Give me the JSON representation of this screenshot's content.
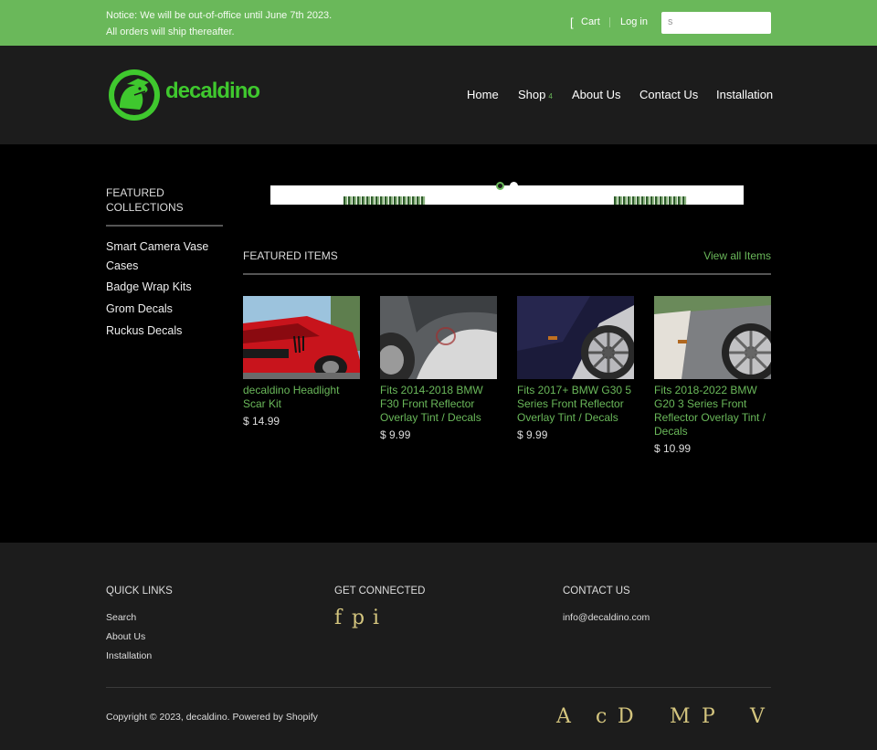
{
  "topbar": {
    "notice_line1": "Notice: We will be out-of-office until June 7th 2023.",
    "notice_line2": "All orders will ship thereafter.",
    "cart_icon": "[",
    "cart_label": "Cart",
    "login_label": "Log in",
    "search_icon": "s",
    "search_placeholder": ""
  },
  "header": {
    "logo_text": "decaldino",
    "nav": {
      "home": "Home",
      "shop": "Shop",
      "shop_caret": "4",
      "about": "About Us",
      "contact": "Contact Us",
      "installation": "Installation"
    }
  },
  "sidebar": {
    "title": "FEATURED COLLECTIONS",
    "items": [
      "Smart Camera Vase Cases",
      "Badge Wrap Kits",
      "Grom Decals",
      "Ruckus Decals"
    ]
  },
  "featured": {
    "title": "FEATURED ITEMS",
    "view_all": "View all Items",
    "products": [
      {
        "name": "decaldino Headlight Scar Kit",
        "price": "$ 14.99"
      },
      {
        "name": "Fits 2014-2018 BMW F30 Front Reflector Overlay Tint / Decals",
        "price": "$ 9.99"
      },
      {
        "name": "Fits 2017+ BMW G30 5 Series Front Reflector Overlay Tint / Decals",
        "price": "$ 9.99"
      },
      {
        "name": "Fits 2018-2022 BMW G20 3 Series Front Reflector Overlay Tint / Decals",
        "price": "$ 10.99"
      }
    ]
  },
  "footer": {
    "quick_links_title": "QUICK LINKS",
    "quick_links": [
      "Search",
      "About Us",
      "Installation"
    ],
    "connected_title": "GET CONNECTED",
    "social": {
      "facebook": "f",
      "pinterest": "p",
      "instagram": "i"
    },
    "contact_title": "CONTACT US",
    "contact_email": "info@decaldino.com",
    "copyright": "Copyright © 2023, decaldino. Powered by Shopify",
    "payment_icons": [
      "A",
      "c",
      "D",
      "M",
      "P",
      "V"
    ]
  },
  "colors": {
    "accent": "#6ab85a",
    "logo_green": "#3fc82e",
    "header_bg": "#1c1c1c",
    "page_bg": "#000000",
    "icon_gold": "#d4c57e"
  }
}
